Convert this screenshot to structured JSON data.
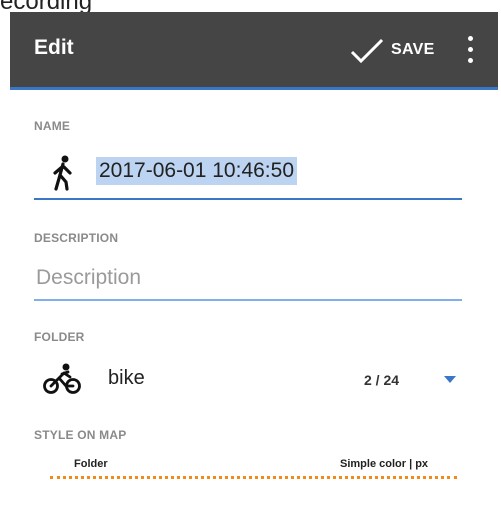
{
  "caption": "ecording",
  "toolbar": {
    "title": "Edit",
    "save_label": "SAVE",
    "colors": {
      "background": "#454545",
      "accent": "#3a78c7"
    },
    "icons": [
      "check-icon",
      "more-vert-icon"
    ]
  },
  "name_section": {
    "label": "NAME",
    "value": "2017-06-01 10:46:50",
    "icon": "walking-person-icon"
  },
  "description_section": {
    "label": "DESCRIPTION",
    "placeholder": "Description",
    "value": ""
  },
  "folder_section": {
    "label": "FOLDER",
    "icon": "bicycle-icon",
    "folder_name": "bike",
    "count": "2 / 24",
    "dropdown_icon": "dropdown-arrow-icon"
  },
  "style_section": {
    "label": "STYLE ON MAP",
    "left_text": "Folder",
    "right_text": "Simple color | px",
    "line_color": "#f28a1a"
  }
}
